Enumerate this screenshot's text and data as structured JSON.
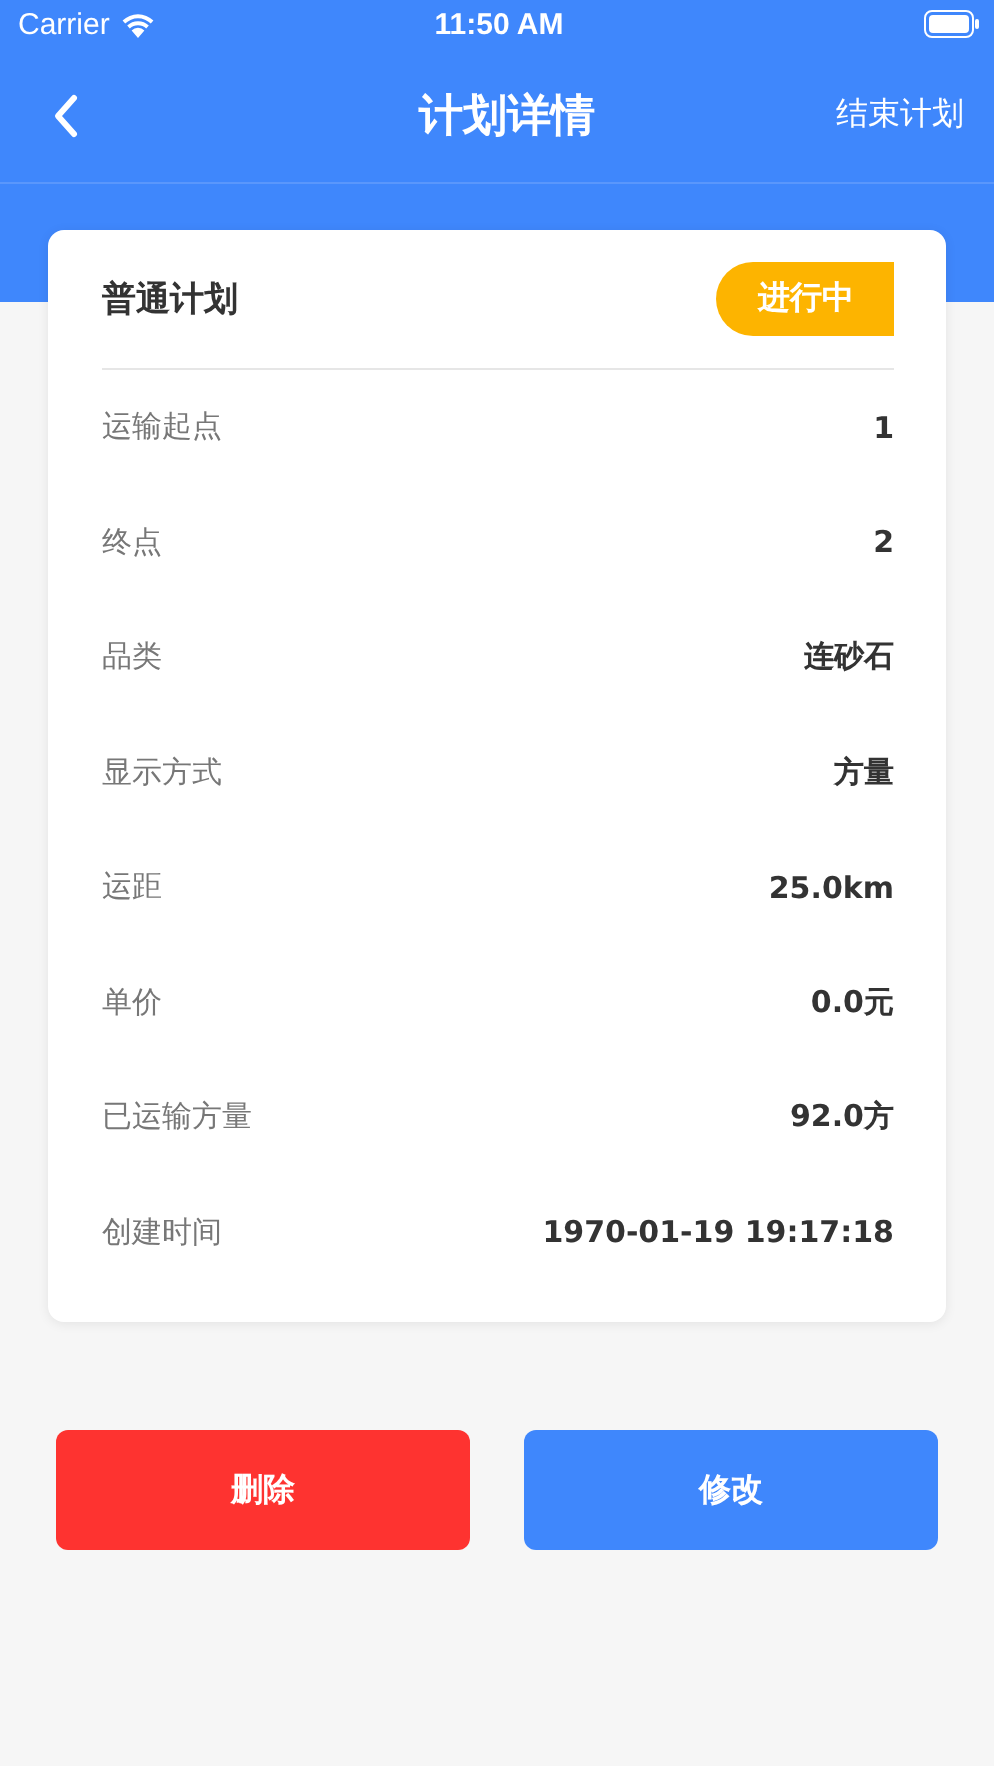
{
  "status_bar": {
    "carrier": "Carrier",
    "time": "11:50 AM"
  },
  "nav": {
    "title": "计划详情",
    "action": "结束计划"
  },
  "card": {
    "title": "普通计划",
    "badge": "进行中",
    "rows": [
      {
        "label": "运输起点",
        "value": "1"
      },
      {
        "label": "终点",
        "value": "2"
      },
      {
        "label": "品类",
        "value": "连砂石"
      },
      {
        "label": "显示方式",
        "value": "方量"
      },
      {
        "label": "运距",
        "value": "25.0km"
      },
      {
        "label": "单价",
        "value": "0.0元"
      },
      {
        "label": "已运输方量",
        "value": "92.0方"
      },
      {
        "label": "创建时间",
        "value": "1970-01-19 19:17:18"
      }
    ]
  },
  "buttons": [
    {
      "label": "删除",
      "kind": "danger"
    },
    {
      "label": "修改",
      "kind": "primary"
    }
  ]
}
